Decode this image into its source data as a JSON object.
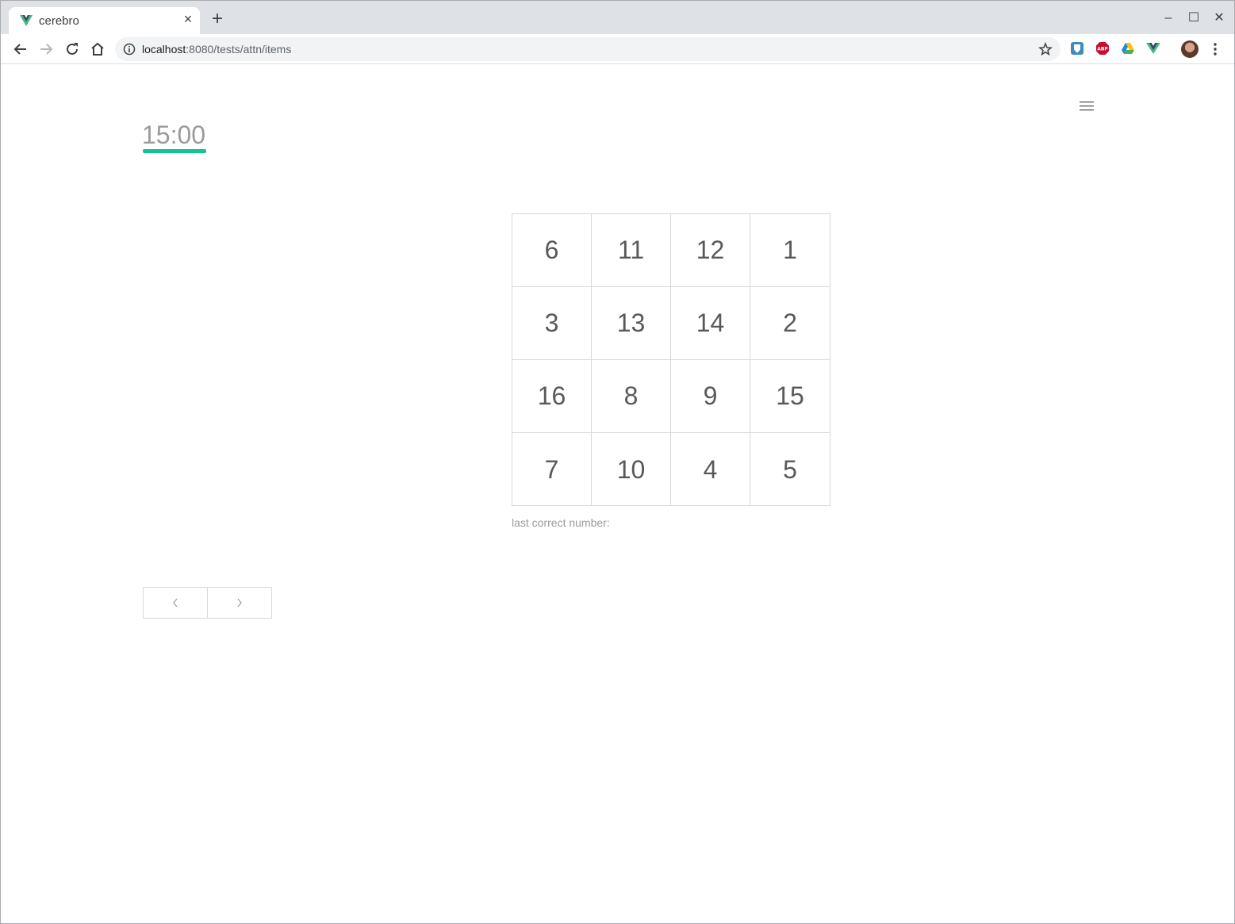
{
  "browser": {
    "tab": {
      "title": "cerebro",
      "close_glyph": "×"
    },
    "new_tab_glyph": "+",
    "window_controls": {
      "minimize": "–",
      "maximize": "☐",
      "close": "✕"
    },
    "address": {
      "host": "localhost",
      "rest": ":8080/tests/attn/items"
    },
    "colors": {
      "tabstrip": "#dee1e6",
      "omnibox": "#f1f3f4"
    }
  },
  "page": {
    "timer": "15:00",
    "accent_color": "#12c694",
    "grid": {
      "rows": [
        [
          "6",
          "11",
          "12",
          "1"
        ],
        [
          "3",
          "13",
          "14",
          "2"
        ],
        [
          "16",
          "8",
          "9",
          "15"
        ],
        [
          "7",
          "10",
          "4",
          "5"
        ]
      ]
    },
    "last_correct_label": "last correct number:",
    "pager": {
      "prev_icon": "chevron-left-icon",
      "next_icon": "chevron-right-icon"
    }
  }
}
